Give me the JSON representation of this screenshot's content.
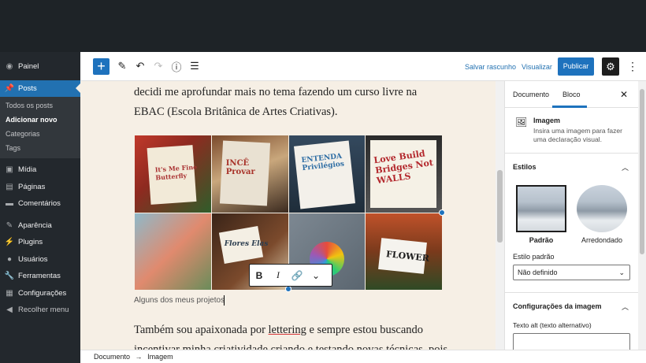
{
  "sidebar": {
    "items": [
      {
        "label": "Painel",
        "icon": "dashboard-icon"
      },
      {
        "label": "Posts",
        "icon": "pin-icon"
      },
      {
        "label": "Mídia",
        "icon": "media-icon"
      },
      {
        "label": "Páginas",
        "icon": "pages-icon"
      },
      {
        "label": "Comentários",
        "icon": "comments-icon"
      },
      {
        "label": "Aparência",
        "icon": "appearance-icon"
      },
      {
        "label": "Plugins",
        "icon": "plugins-icon"
      },
      {
        "label": "Usuários",
        "icon": "users-icon"
      },
      {
        "label": "Ferramentas",
        "icon": "tools-icon"
      },
      {
        "label": "Configurações",
        "icon": "settings-icon"
      },
      {
        "label": "Recolher menu",
        "icon": "collapse-icon"
      }
    ],
    "posts_submenu": [
      "Todos os posts",
      "Adicionar novo",
      "Categorias",
      "Tags"
    ]
  },
  "header": {
    "save_draft": "Salvar rascunho",
    "preview": "Visualizar",
    "publish": "Publicar"
  },
  "content": {
    "paragraph1": "decidi me aprofundar mais no tema fazendo um curso livre na EBAC (Escola Britânica de Artes Criativas).",
    "caption": "Alguns dos meus projetos",
    "paragraph2_pre": "Também sou apaixonada por ",
    "paragraph2_link": "lettering",
    "paragraph2_post": " e sempre estou buscando incentivar minha criatividade criando e testando novas técnicas, pois"
  },
  "gallery": {
    "tiles": [
      {
        "text": "It's Me Fine Butterfly",
        "bg": "#c0392b"
      },
      {
        "text": "INCÊ Provar",
        "bg": "#8a5a3b"
      },
      {
        "text": "ENTENDA Privilégios",
        "bg": "#2c3e50"
      },
      {
        "text": "Love Build Bridges Not WALLS",
        "bg": "#3d3d3d"
      },
      {
        "text": "",
        "bg": "#5e8fa3"
      },
      {
        "text": "Flores Elas",
        "bg": "#3a2418"
      },
      {
        "text": "",
        "bg": "#6b7a86"
      },
      {
        "text": "FLOWER",
        "bg": "#c0522a"
      }
    ]
  },
  "format_toolbar": {
    "bold": "B",
    "italic": "I",
    "link_icon": "link-icon",
    "more_icon": "chevron-down-icon"
  },
  "panel": {
    "tab_document": "Documento",
    "tab_block": "Bloco",
    "block_name": "Imagem",
    "block_desc": "Insira uma imagem para fazer uma declaração visual.",
    "styles_title": "Estilos",
    "style_default": "Padrão",
    "style_rounded": "Arredondado",
    "default_style_label": "Estilo padrão",
    "default_style_value": "Não definido",
    "image_settings_title": "Configurações da imagem",
    "alt_label": "Texto alt (texto alternativo)"
  },
  "footer": {
    "crumb1": "Documento",
    "arrow": "→",
    "crumb2": "Imagem"
  },
  "colors": {
    "accent": "#1e72bd",
    "admin_bg": "#23282d",
    "canvas_bg": "#f6efe5"
  }
}
